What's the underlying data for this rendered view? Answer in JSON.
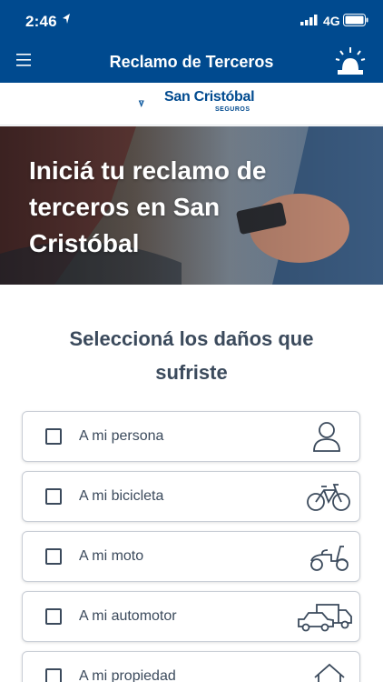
{
  "status_bar": {
    "time": "2:46",
    "network": "4G"
  },
  "nav": {
    "title": "Reclamo de Terceros",
    "menu_icon": "hamburger-menu-icon",
    "action_icon": "emergency-siren-icon"
  },
  "brand": {
    "name": "San Cristóbal",
    "sub": "SEGUROS",
    "color": "#004a8f"
  },
  "hero": {
    "title": "Iniciá tu reclamo de terceros en San Cristóbal"
  },
  "section": {
    "title": "Seleccioná los daños que sufriste"
  },
  "options": [
    {
      "label": "A mi persona",
      "icon": "person-icon",
      "checked": false
    },
    {
      "label": "A mi bicicleta",
      "icon": "bicycle-icon",
      "checked": false
    },
    {
      "label": "A mi moto",
      "icon": "scooter-icon",
      "checked": false
    },
    {
      "label": "A mi automotor",
      "icon": "car-truck-icon",
      "checked": false
    },
    {
      "label": "A mi propiedad",
      "icon": "house-icon",
      "checked": false
    }
  ]
}
